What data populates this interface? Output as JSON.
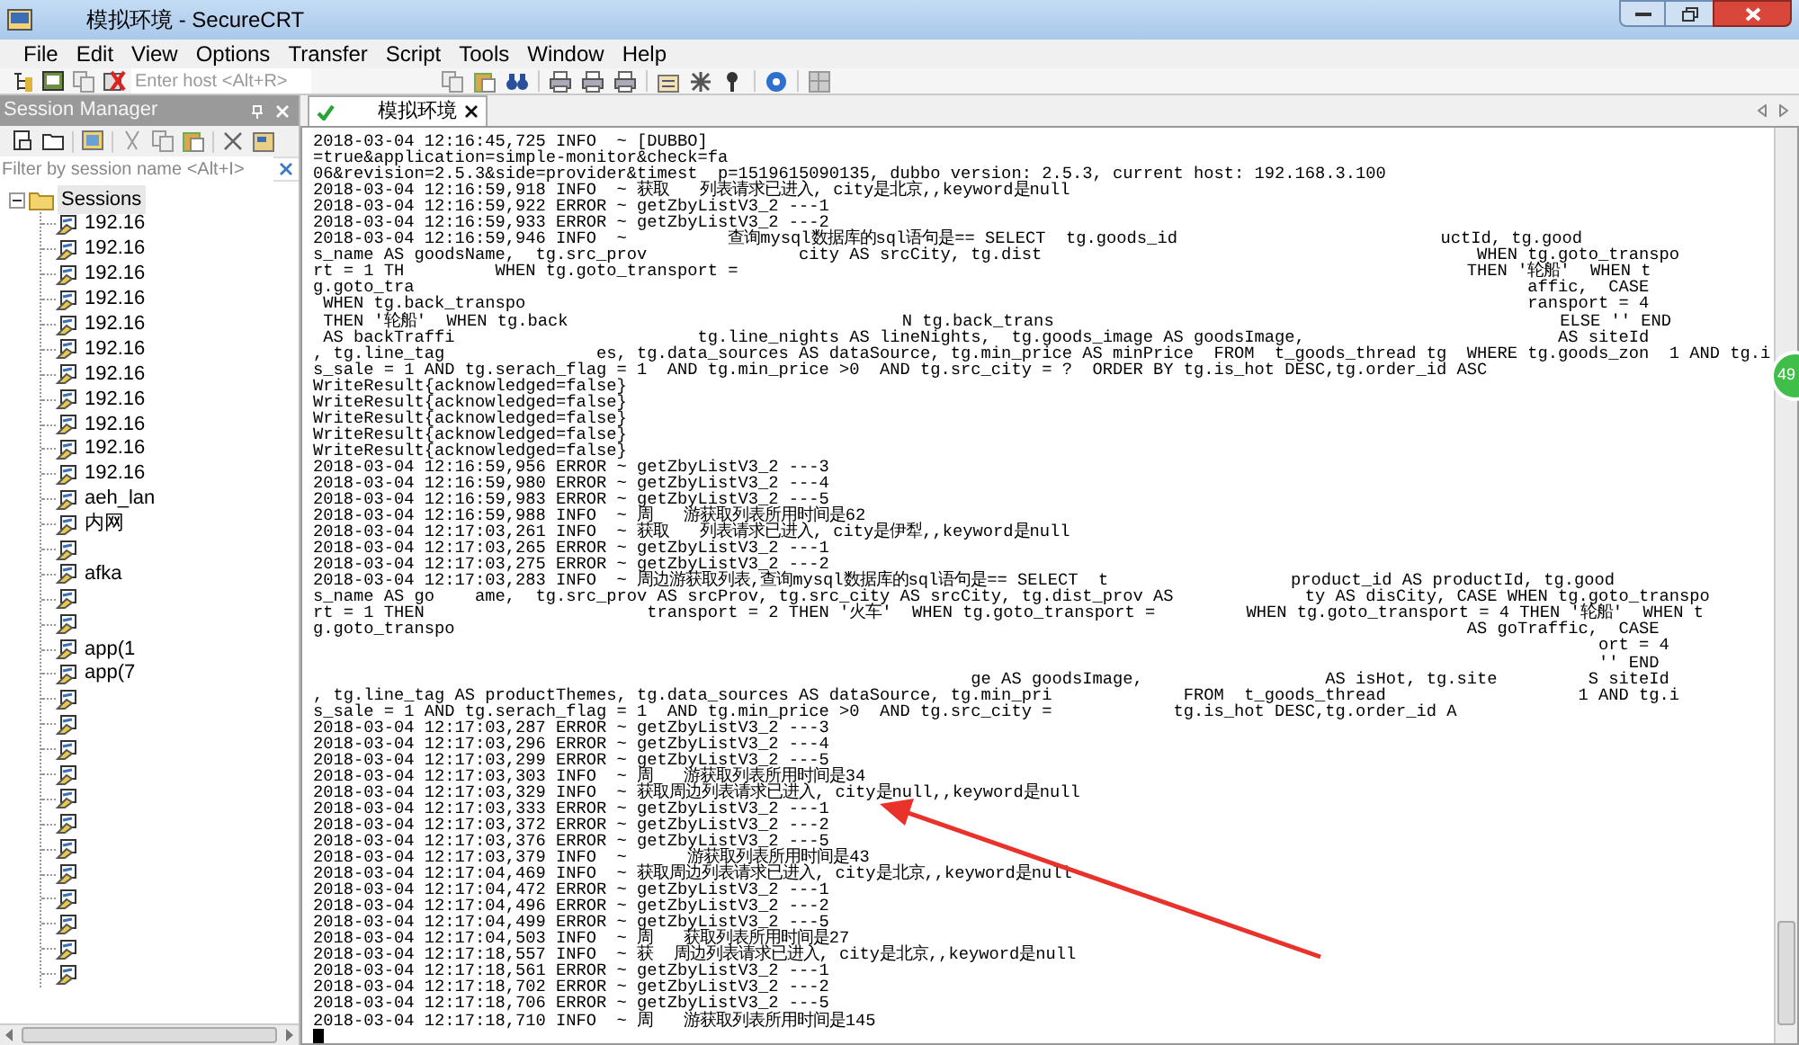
{
  "window": {
    "title": "模拟环境 - SecureCRT"
  },
  "menu": [
    "File",
    "Edit",
    "View",
    "Options",
    "Transfer",
    "Script",
    "Tools",
    "Window",
    "Help"
  ],
  "toolbar": {
    "host_field": {
      "placeholder": "Enter host <Alt+R>"
    }
  },
  "session_manager": {
    "title": "Session Manager",
    "filter": {
      "placeholder": "Filter by session name <Alt+I>"
    },
    "tree": {
      "label": "Sessions",
      "expanded": true,
      "children": [
        {
          "kind": "session",
          "label": "192.16"
        },
        {
          "kind": "session",
          "label": "192.16"
        },
        {
          "kind": "session",
          "label": "192.16"
        },
        {
          "kind": "session",
          "label": "192.16"
        },
        {
          "kind": "session",
          "label": "192.16"
        },
        {
          "kind": "session",
          "label": "192.16"
        },
        {
          "kind": "session",
          "label": "192.16"
        },
        {
          "kind": "session",
          "label": "192.16"
        },
        {
          "kind": "session",
          "label": "192.16"
        },
        {
          "kind": "session",
          "label": "192.16"
        },
        {
          "kind": "session",
          "label": "192.16"
        },
        {
          "kind": "session",
          "label": "aeh_lan"
        },
        {
          "kind": "session",
          "label": "内网"
        },
        {
          "kind": "session"
        },
        {
          "kind": "session",
          "label": "afka"
        },
        {
          "kind": "session"
        },
        {
          "kind": "session"
        },
        {
          "kind": "session",
          "label": "app(1"
        },
        {
          "kind": "session",
          "label": "app(7"
        },
        {
          "kind": "session"
        },
        {
          "kind": "session"
        },
        {
          "kind": "session"
        },
        {
          "kind": "session"
        },
        {
          "kind": "session"
        },
        {
          "kind": "session"
        },
        {
          "kind": "session"
        },
        {
          "kind": "session"
        },
        {
          "kind": "session"
        },
        {
          "kind": "session"
        },
        {
          "kind": "session"
        },
        {
          "kind": "session"
        }
      ]
    }
  },
  "tabs": [
    {
      "label": "模拟环境",
      "selected": true,
      "connected": true
    }
  ],
  "terminal": {
    "lines": [
      "2018-03-04 12:16:45,725 INFO  ~ [DUBBO]",
      "=true&application=simple-monitor&check=fa",
      "06&revision=2.5.3&side=provider&timest  p=1519615090135, dubbo version: 2.5.3, current host: 192.168.3.100",
      "2018-03-04 12:16:59,918 INFO  ~ 获取   列表请求已进入, city是北京,,keyword是null",
      "2018-03-04 12:16:59,922 ERROR ~ getZbyListV3_2 ---1",
      "2018-03-04 12:16:59,933 ERROR ~ getZbyListV3_2 ---2",
      "2018-03-04 12:16:59,946 INFO  ~          查询mysql数据库的sql语句是== SELECT  tg.goods_id                          uctId, tg.good",
      "s_name AS goodsName,  tg.src_prov               city AS srcCity, tg.dist                                           WHEN tg.goto_transpo",
      "rt = 1 TH         WHEN tg.goto_transport =                                                                        THEN '轮船'  WHEN t",
      "g.goto_tra                                                                                                              affic,  CASE",
      " WHEN tg.back_transpo                                                                                                   ransport = 4",
      " THEN '轮船'  WHEN tg.back                                 N tg.back_trans                                                  ELSE '' END",
      " AS backTraffi                        tg.line_nights AS lineNights,  tg.goods_image AS goodsImage,                         AS siteId",
      ", tg.line_tag               es, tg.data_sources AS dataSource, tg.min_price AS minPrice  FROM  t_goods_thread tg  WHERE tg.goods_zon  1 AND tg.i",
      "s_sale = 1 AND tg.serach_flag = 1  AND tg.min_price >0  AND tg.src_city = ?  ORDER BY tg.is_hot DESC,tg.order_id ASC",
      "WriteResult{acknowledged=false}",
      "WriteResult{acknowledged=false}",
      "WriteResult{acknowledged=false}",
      "WriteResult{acknowledged=false}",
      "WriteResult{acknowledged=false}",
      "2018-03-04 12:16:59,956 ERROR ~ getZbyListV3_2 ---3",
      "2018-03-04 12:16:59,980 ERROR ~ getZbyListV3_2 ---4",
      "2018-03-04 12:16:59,983 ERROR ~ getZbyListV3_2 ---5",
      "2018-03-04 12:16:59,988 INFO  ~ 周   游获取列表所用时间是62",
      "2018-03-04 12:17:03,261 INFO  ~ 获取   列表请求已进入, city是伊犁,,keyword是null",
      "2018-03-04 12:17:03,265 ERROR ~ getZbyListV3_2 ---1",
      "2018-03-04 12:17:03,275 ERROR ~ getZbyListV3_2 ---2",
      "2018-03-04 12:17:03,283 INFO  ~ 周边游获取列表,查询mysql数据库的sql语句是== SELECT  t                  product_id AS productId, tg.good",
      "s_name AS go    ame,  tg.src_prov AS srcProv, tg.src_city AS srcCity, tg.dist_prov AS             ty AS disCity, CASE WHEN tg.goto_transpo",
      "rt = 1 THEN                      transport = 2 THEN '火车'  WHEN tg.goto_transport =         WHEN tg.goto_transport = 4 THEN '轮船'  WHEN t",
      "g.goto_transpo                                                                                                    AS goTraffic,  CASE",
      "                                                                                                                               ort = 4",
      "                                                                                                                               '' END",
      "                                                                 ge AS goodsImage,                  AS isHot, tg.site         S siteId",
      ", tg.line_tag AS productThemes, tg.data_sources AS dataSource, tg.min_pri             FROM  t_goods_thread                   1 AND tg.i",
      "s_sale = 1 AND tg.serach_flag = 1  AND tg.min_price >0  AND tg.src_city =            tg.is_hot DESC,tg.order_id A",
      "2018-03-04 12:17:03,287 ERROR ~ getZbyListV3_2 ---3",
      "2018-03-04 12:17:03,296 ERROR ~ getZbyListV3_2 ---4",
      "2018-03-04 12:17:03,299 ERROR ~ getZbyListV3_2 ---5",
      "2018-03-04 12:17:03,303 INFO  ~ 周   游获取列表所用时间是34",
      "2018-03-04 12:17:03,329 INFO  ~ 获取周边列表请求已进入, city是null,,keyword是null",
      "2018-03-04 12:17:03,333 ERROR ~ getZbyListV3_2 ---1",
      "2018-03-04 12:17:03,372 ERROR ~ getZbyListV3_2 ---2",
      "2018-03-04 12:17:03,376 ERROR ~ getZbyListV3_2 ---5",
      "2018-03-04 12:17:03,379 INFO  ~      游获取列表所用时间是43",
      "2018-03-04 12:17:04,469 INFO  ~ 获取周边列表请求已进入, city是北京,,keyword是null",
      "2018-03-04 12:17:04,472 ERROR ~ getZbyListV3_2 ---1",
      "2018-03-04 12:17:04,496 ERROR ~ getZbyListV3_2 ---2",
      "2018-03-04 12:17:04,499 ERROR ~ getZbyListV3_2 ---5",
      "2018-03-04 12:17:04,503 INFO  ~ 周   获取列表所用时间是27",
      "2018-03-04 12:17:18,557 INFO  ~ 获  周边列表请求已进入, city是北京,,keyword是null",
      "2018-03-04 12:17:18,561 ERROR ~ getZbyListV3_2 ---1",
      "2018-03-04 12:17:18,702 ERROR ~ getZbyListV3_2 ---2",
      "2018-03-04 12:17:18,706 ERROR ~ getZbyListV3_2 ---5",
      "2018-03-04 12:17:18,710 INFO  ~ 周   游获取列表所用时间是145"
    ]
  },
  "side_badge": "49"
}
